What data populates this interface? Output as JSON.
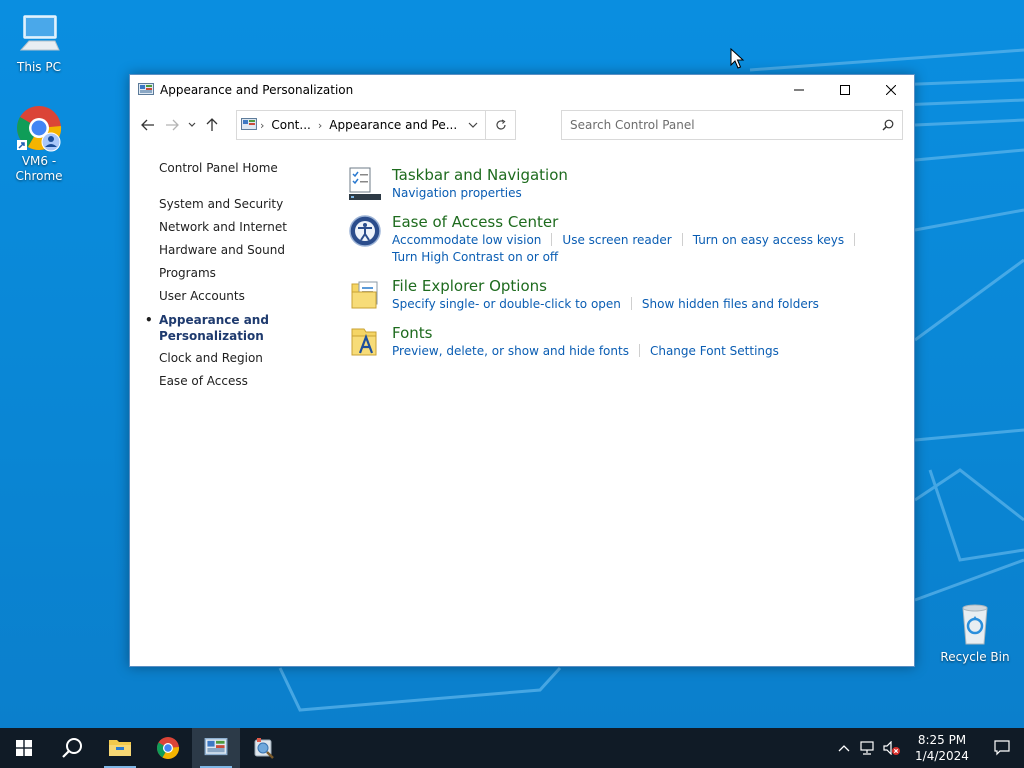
{
  "desktop": {
    "icons": [
      {
        "label": "This PC"
      },
      {
        "label": "VM6 - Chrome"
      },
      {
        "label": "Recycle Bin"
      }
    ]
  },
  "window": {
    "title": "Appearance and Personalization",
    "address": {
      "crumbs": [
        "Cont...",
        "Appearance and Pe..."
      ]
    },
    "search": {
      "placeholder": "Search Control Panel"
    }
  },
  "sidebar": {
    "home": "Control Panel Home",
    "items": [
      {
        "label": "System and Security"
      },
      {
        "label": "Network and Internet"
      },
      {
        "label": "Hardware and Sound"
      },
      {
        "label": "Programs"
      },
      {
        "label": "User Accounts"
      },
      {
        "label": "Appearance and Personalization",
        "active": true
      },
      {
        "label": "Clock and Region"
      },
      {
        "label": "Ease of Access"
      }
    ]
  },
  "categories": [
    {
      "title": "Taskbar and Navigation",
      "icon": "taskbar-icon",
      "links": [
        "Navigation properties"
      ]
    },
    {
      "title": "Ease of Access Center",
      "icon": "ease-of-access-icon",
      "links": [
        "Accommodate low vision",
        "Use screen reader",
        "Turn on easy access keys",
        "Turn High Contrast on or off"
      ]
    },
    {
      "title": "File Explorer Options",
      "icon": "folder-options-icon",
      "links": [
        "Specify single- or double-click to open",
        "Show hidden files and folders"
      ]
    },
    {
      "title": "Fonts",
      "icon": "fonts-icon",
      "links": [
        "Preview, delete, or show and hide fonts",
        "Change Font Settings"
      ]
    }
  ],
  "taskbar": {
    "clock": {
      "time": "8:25 PM",
      "date": "1/4/2024"
    }
  },
  "colors": {
    "link": "#0a5db3",
    "category_title": "#1e6b1e",
    "taskbar": "#101b26",
    "desktop": "#0a87d6"
  }
}
